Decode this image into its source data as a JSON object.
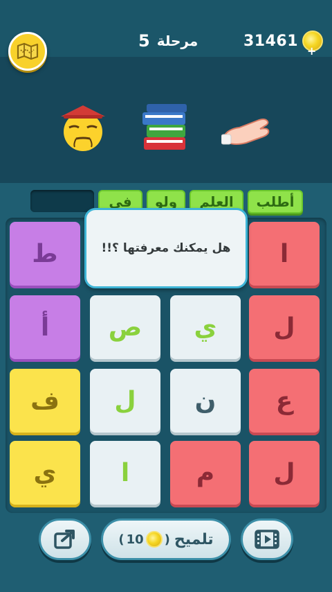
{
  "header": {
    "level_label": "مرحلة",
    "level_number": "5",
    "coins": "31461",
    "plus": "+"
  },
  "clue": {
    "images": [
      "face-with-hat-icon",
      "books-icon",
      "open-hand-icon"
    ]
  },
  "answer": {
    "words": [
      "أطلب",
      "العلم",
      "ولو",
      "في"
    ]
  },
  "popup": {
    "text": "هل يمكنك معرفتها ؟!!"
  },
  "grid": {
    "rows": [
      [
        "ط",
        "",
        "",
        "ا"
      ],
      [
        "أ",
        "ص",
        "ي",
        "ل"
      ],
      [
        "ف",
        "ل",
        "ن",
        "ع"
      ],
      [
        "ي",
        "ا",
        "م",
        "ل"
      ]
    ]
  },
  "bottom": {
    "hint_label": "تلميح",
    "hint_cost": "10",
    "hint_open": "(",
    "hint_close": ")"
  },
  "colors": {
    "purple": "#c77ee6",
    "red": "#f46f74",
    "yellow": "#fbe34c",
    "white": "#e9f1f4",
    "green": "#8fe24a"
  }
}
